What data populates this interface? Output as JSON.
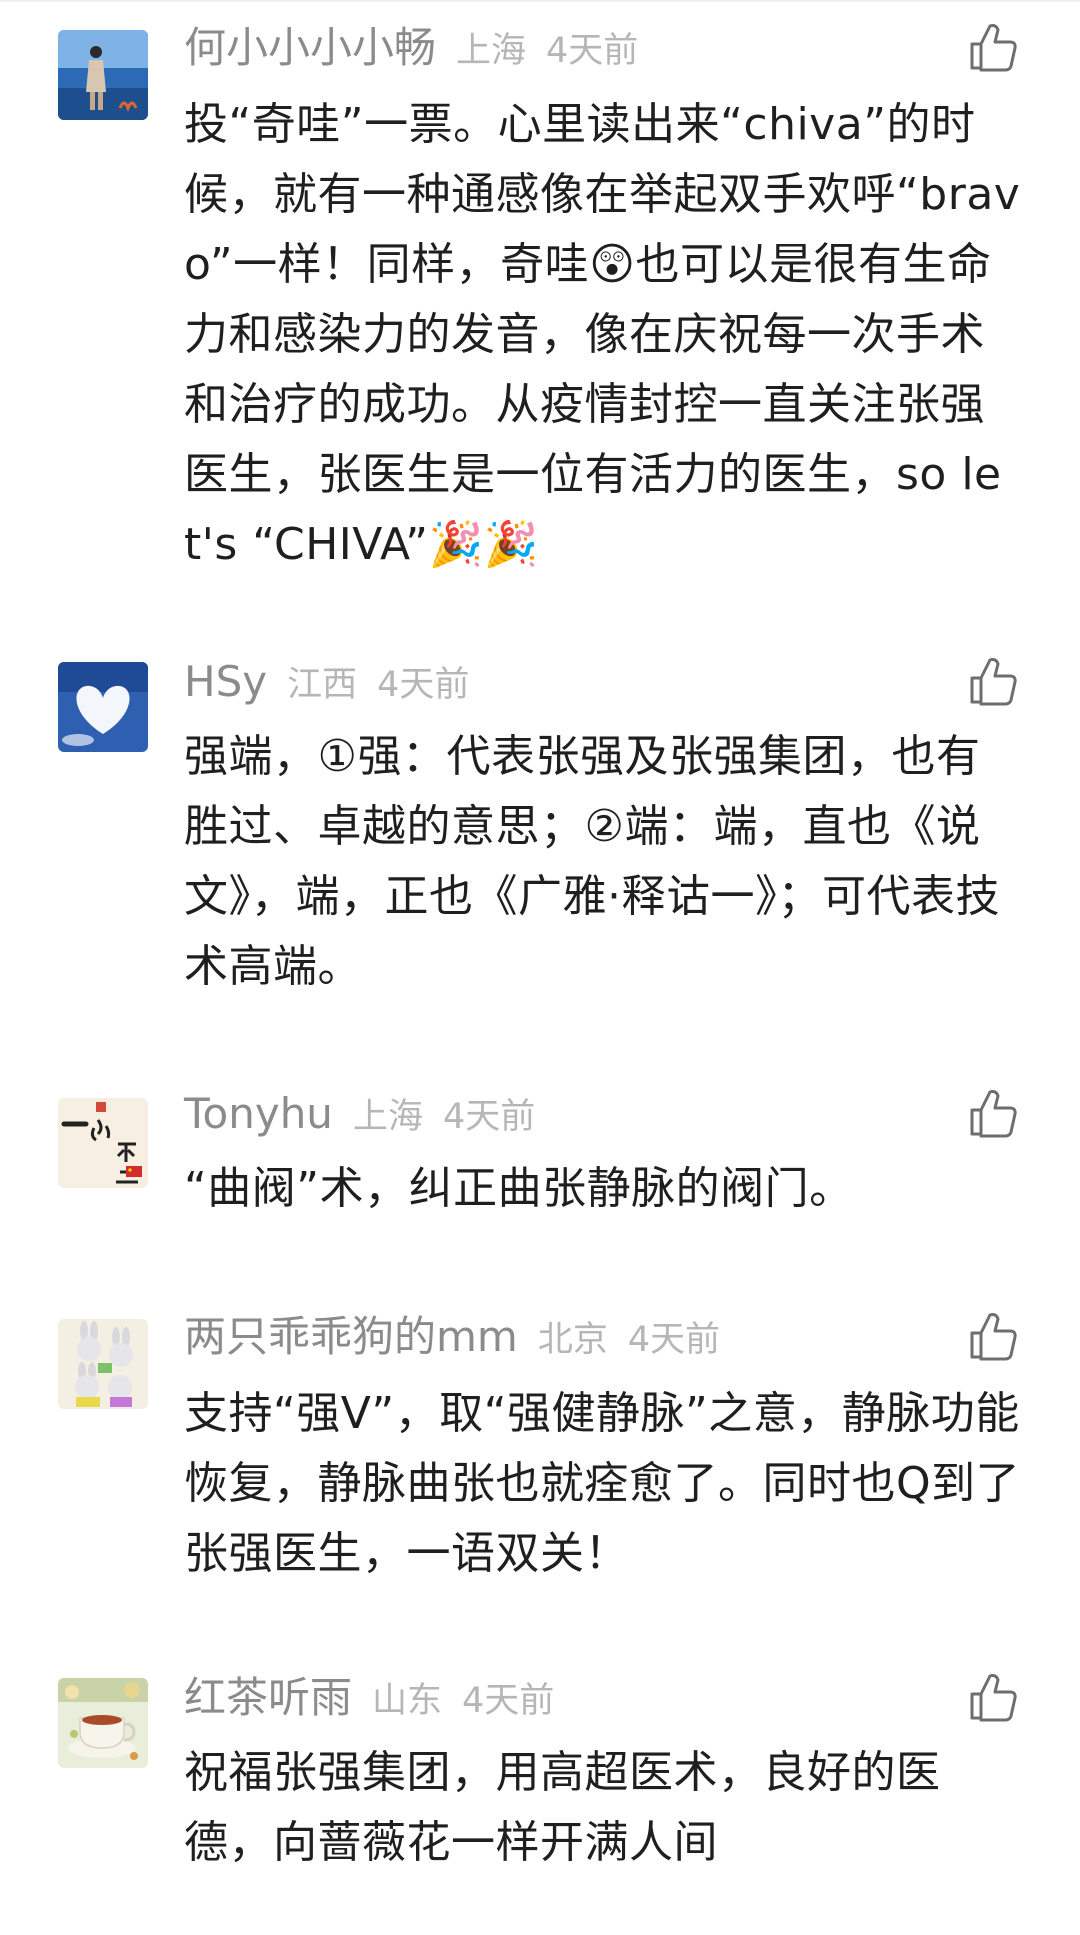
{
  "comments": [
    {
      "nickname": "何小小小小畅",
      "region": "上海",
      "time": "4天前",
      "text": "投“奇哇”一票。心里读出来“chiva”的时候，就有一种通感像在举起双手欢呼“bravo”一样！同样，奇哇😲也可以是很有生命力和感染力的发音，像在庆祝每一次手术和治疗的成功。从疫情封控一直关注张强医生，张医生是一位有活力的医生，so let's “CHIVA”🎉🎉",
      "avatar_icon": "avatar-person-at-sea",
      "like_icon": "thumbs-up-icon"
    },
    {
      "nickname": "HSy",
      "region": "江西",
      "time": "4天前",
      "text": "强端，①强：代表张强及张强集团，也有胜过、卓越的意思；②端：端，直也《说文》，端，正也《广雅·释诂一》；可代表技术高端。",
      "avatar_icon": "avatar-heart-cloud",
      "like_icon": "thumbs-up-icon"
    },
    {
      "nickname": "Tonyhu",
      "region": "上海",
      "time": "4天前",
      "text": "“曲阀”术，纠正曲张静脉的阀门。",
      "avatar_icon": "avatar-calligraphy",
      "like_icon": "thumbs-up-icon"
    },
    {
      "nickname": "两只乖乖狗的mm",
      "region": "北京",
      "time": "4天前",
      "text": "支持“强V”，取“强健静脉”之意，静脉功能恢复，静脉曲张也就痊愈了。同时也Q到了张强医生，一语双关！",
      "avatar_icon": "avatar-bunnies",
      "like_icon": "thumbs-up-icon"
    },
    {
      "nickname": "红茶听雨",
      "region": "山东",
      "time": "4天前",
      "text": "祝福张强集团，用高超医术，良好的医德，向蔷薇花一样开满人间",
      "avatar_icon": "avatar-tea-cup",
      "like_icon": "thumbs-up-icon"
    }
  ],
  "colors": {
    "nickname": "#8b8b8b",
    "meta": "#b6b6b6",
    "body_text": "#1f1f1f",
    "background": "#ffffff"
  }
}
